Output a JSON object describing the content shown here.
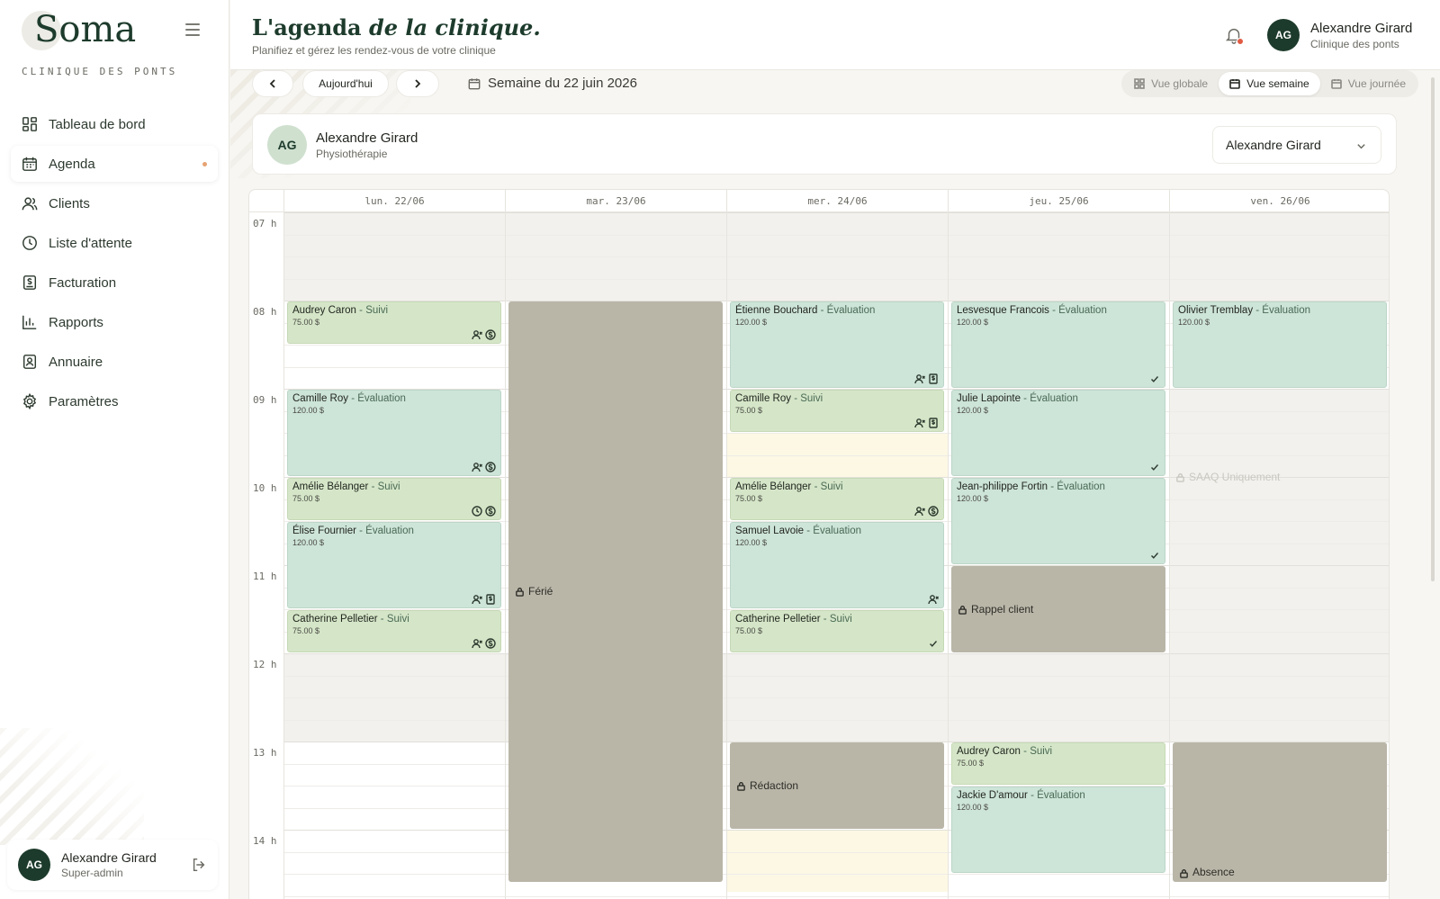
{
  "brand": {
    "name": "Soma",
    "subtitle": "CLINIQUE DES PONTS"
  },
  "sidebar": {
    "items": [
      {
        "label": "Tableau de bord",
        "icon": "dashboard-icon"
      },
      {
        "label": "Agenda",
        "icon": "calendar-icon",
        "active": true
      },
      {
        "label": "Clients",
        "icon": "users-icon"
      },
      {
        "label": "Liste d'attente",
        "icon": "clock-icon"
      },
      {
        "label": "Facturation",
        "icon": "invoice-icon"
      },
      {
        "label": "Rapports",
        "icon": "bar-chart-icon"
      },
      {
        "label": "Annuaire",
        "icon": "contact-book-icon"
      },
      {
        "label": "Paramètres",
        "icon": "gear-icon"
      }
    ],
    "user": {
      "initials": "AG",
      "name": "Alexandre Girard",
      "role": "Super-admin"
    }
  },
  "header": {
    "title_part1": "L'agenda ",
    "title_part2": "de la clinique.",
    "subtitle": "Planifiez et gérez les rendez-vous de votre clinique",
    "user": {
      "initials": "AG",
      "name": "Alexandre Girard",
      "clinic": "Clinique des ponts"
    }
  },
  "toolbar": {
    "today_label": "Aujourd'hui",
    "week_label": "Semaine du 22 juin 2026",
    "views": [
      "Vue globale",
      "Vue semaine",
      "Vue journée"
    ],
    "active_view": "Vue semaine"
  },
  "practitioner": {
    "initials": "AG",
    "name": "Alexandre Girard",
    "specialty": "Physiothérapie",
    "selected": "Alexandre Girard"
  },
  "calendar": {
    "days": [
      "lun. 22/06",
      "mar. 23/06",
      "mer. 24/06",
      "jeu. 25/06",
      "ven. 26/06"
    ],
    "hours": [
      "07 h",
      "08 h",
      "09 h",
      "10 h",
      "11 h",
      "12 h",
      "13 h",
      "14 h"
    ],
    "appointments": [
      {
        "day": 0,
        "start": 8.0,
        "end": 8.5,
        "client": "Audrey Caron",
        "type": "Suivi",
        "price": "75.00 $",
        "icons": [
          "person-x-icon",
          "dollar-icon"
        ]
      },
      {
        "day": 0,
        "start": 9.0,
        "end": 10.0,
        "client": "Camille Roy",
        "type": "Évaluation",
        "price": "120.00 $",
        "icons": [
          "person-x-icon",
          "dollar-icon"
        ]
      },
      {
        "day": 0,
        "start": 10.0,
        "end": 10.5,
        "client": "Amélie Bélanger",
        "type": "Suivi",
        "price": "75.00 $",
        "icons": [
          "clock-icon",
          "dollar-icon"
        ]
      },
      {
        "day": 0,
        "start": 10.5,
        "end": 11.5,
        "client": "Élise Fournier",
        "type": "Évaluation",
        "price": "120.00 $",
        "icons": [
          "person-x-icon",
          "receipt-icon"
        ]
      },
      {
        "day": 0,
        "start": 11.5,
        "end": 12.0,
        "client": "Catherine Pelletier",
        "type": "Suivi",
        "price": "75.00 $",
        "icons": [
          "person-x-icon",
          "dollar-icon"
        ]
      },
      {
        "day": 2,
        "start": 8.0,
        "end": 9.0,
        "client": "Étienne Bouchard",
        "type": "Évaluation",
        "price": "120.00 $",
        "icons": [
          "person-x-icon",
          "receipt-icon"
        ]
      },
      {
        "day": 2,
        "start": 9.0,
        "end": 9.5,
        "client": "Camille Roy",
        "type": "Suivi",
        "price": "75.00 $",
        "icons": [
          "person-x-icon",
          "receipt-icon"
        ]
      },
      {
        "day": 2,
        "start": 10.0,
        "end": 10.5,
        "client": "Amélie Bélanger",
        "type": "Suivi",
        "price": "75.00 $",
        "icons": [
          "person-x-icon",
          "dollar-icon"
        ]
      },
      {
        "day": 2,
        "start": 10.5,
        "end": 11.5,
        "client": "Samuel Lavoie",
        "type": "Évaluation",
        "price": "120.00 $",
        "icons": [
          "person-x-icon"
        ]
      },
      {
        "day": 2,
        "start": 11.5,
        "end": 12.0,
        "client": "Catherine Pelletier",
        "type": "Suivi",
        "price": "75.00 $",
        "icons": [
          "check-icon"
        ]
      },
      {
        "day": 3,
        "start": 8.0,
        "end": 9.0,
        "client": "Lesvesque Francois",
        "type": "Évaluation",
        "price": "120.00 $",
        "icons": [
          "check-icon"
        ]
      },
      {
        "day": 3,
        "start": 9.0,
        "end": 10.0,
        "client": "Julie Lapointe",
        "type": "Évaluation",
        "price": "120.00 $",
        "icons": [
          "check-icon"
        ]
      },
      {
        "day": 3,
        "start": 10.0,
        "end": 11.0,
        "client": "Jean-philippe Fortin",
        "type": "Évaluation",
        "price": "120.00 $",
        "icons": [
          "check-icon"
        ]
      },
      {
        "day": 3,
        "start": 13.0,
        "end": 13.5,
        "client": "Audrey Caron",
        "type": "Suivi",
        "price": "75.00 $",
        "icons": []
      },
      {
        "day": 3,
        "start": 13.5,
        "end": 14.5,
        "client": "Jackie D'amour",
        "type": "Évaluation",
        "price": "120.00 $",
        "icons": []
      },
      {
        "day": 4,
        "start": 8.0,
        "end": 9.0,
        "client": "Olivier Tremblay",
        "type": "Évaluation",
        "price": "120.00 $",
        "icons": []
      }
    ],
    "blocks": [
      {
        "day": 1,
        "start": 8.0,
        "end": 14.6,
        "label": "Férié",
        "label_pos": "center"
      },
      {
        "day": 2,
        "start": 13.0,
        "end": 14.0,
        "label": "Rédaction",
        "label_pos": "center"
      },
      {
        "day": 3,
        "start": 11.0,
        "end": 12.0,
        "label": "Rappel client",
        "label_pos": "center"
      },
      {
        "day": 4,
        "start": 13.0,
        "end": 14.6,
        "label": "Absence",
        "label_pos": "bottom"
      }
    ],
    "faint_labels": [
      {
        "day": 4,
        "start": 10.0,
        "label": "SAAQ Uniquement"
      }
    ]
  },
  "colors": {
    "primary": "#1d3b2c",
    "suivi": "#d5e6c8",
    "evaluation": "#cde4d8",
    "block": "#b9b6a8",
    "accent_dot": "#e6a272",
    "notification": "#e15b43"
  }
}
